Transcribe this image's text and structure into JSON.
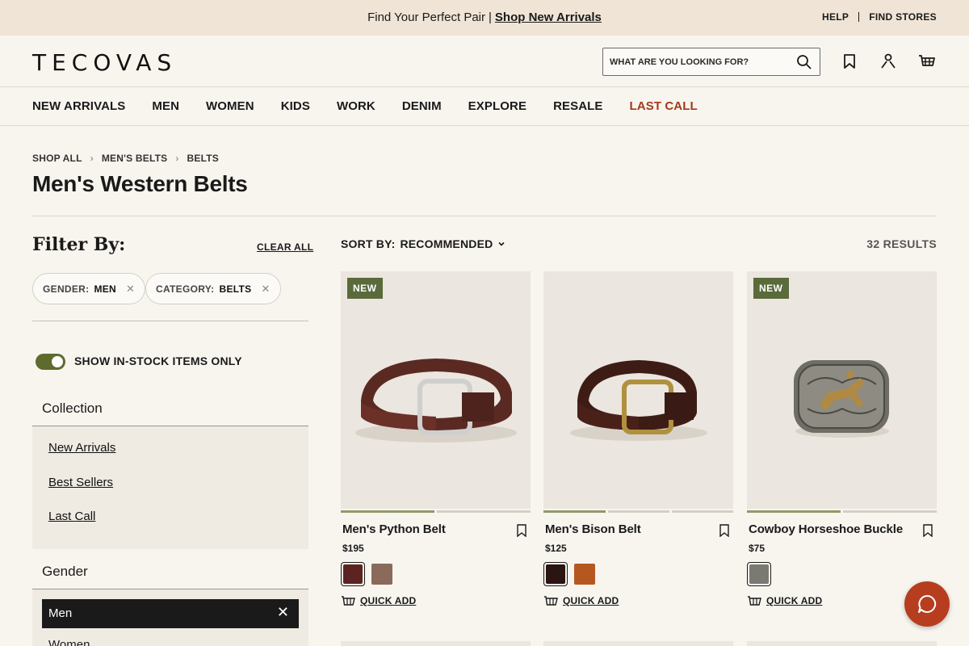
{
  "promo": {
    "message": "Find Your Perfect Pair",
    "separator": "|",
    "link": "Shop New Arrivals"
  },
  "utility": {
    "help": "HELP",
    "stores": "FIND STORES"
  },
  "header": {
    "logo": "TECOVAS",
    "search_placeholder": "WHAT ARE YOU LOOKING FOR?",
    "icons": [
      "search-icon",
      "bookmark-icon",
      "account-icon",
      "cart-icon"
    ]
  },
  "nav": [
    "NEW ARRIVALS",
    "MEN",
    "WOMEN",
    "KIDS",
    "WORK",
    "DENIM",
    "EXPLORE",
    "RESALE",
    "LAST CALL"
  ],
  "nav_accent": "#a5391a",
  "breadcrumb": [
    "SHOP ALL",
    "MEN'S BELTS",
    "BELTS"
  ],
  "page_title": "Men's Western Belts",
  "filters": {
    "heading": "Filter By:",
    "clear_all": "CLEAR ALL",
    "chips": [
      {
        "key": "GENDER:",
        "value": "MEN"
      },
      {
        "key": "CATEGORY:",
        "value": "BELTS"
      }
    ],
    "in_stock_label": "SHOW IN-STOCK ITEMS ONLY",
    "in_stock_on": true,
    "collection": {
      "title": "Collection",
      "links": [
        "New Arrivals",
        "Best Sellers",
        "Last Call"
      ]
    },
    "gender": {
      "title": "Gender",
      "selected": "Men",
      "next": "Women"
    }
  },
  "sort": {
    "label": "SORT BY:",
    "value": "RECOMMENDED"
  },
  "results": "32 RESULTS",
  "products": [
    {
      "badge": "NEW",
      "name": "Men's Python Belt",
      "price": "$195",
      "quick_add": "QUICK ADD",
      "swatches": [
        "#5b2420",
        "#8a6a5a"
      ],
      "image_page": 1,
      "image_pages": 2
    },
    {
      "badge": "",
      "name": "Men's Bison Belt",
      "price": "$125",
      "quick_add": "QUICK ADD",
      "swatches": [
        "#2a1512",
        "#b5581f"
      ],
      "image_page": 1,
      "image_pages": 3
    },
    {
      "badge": "NEW",
      "name": "Cowboy Horseshoe Buckle",
      "price": "$75",
      "quick_add": "QUICK ADD",
      "swatches": [
        "#7a7a72"
      ],
      "image_page": 1,
      "image_pages": 2
    }
  ],
  "colors": {
    "badge": "#5a6a3a",
    "toggle": "#5d6b2e",
    "chat": "#b73d1f"
  }
}
